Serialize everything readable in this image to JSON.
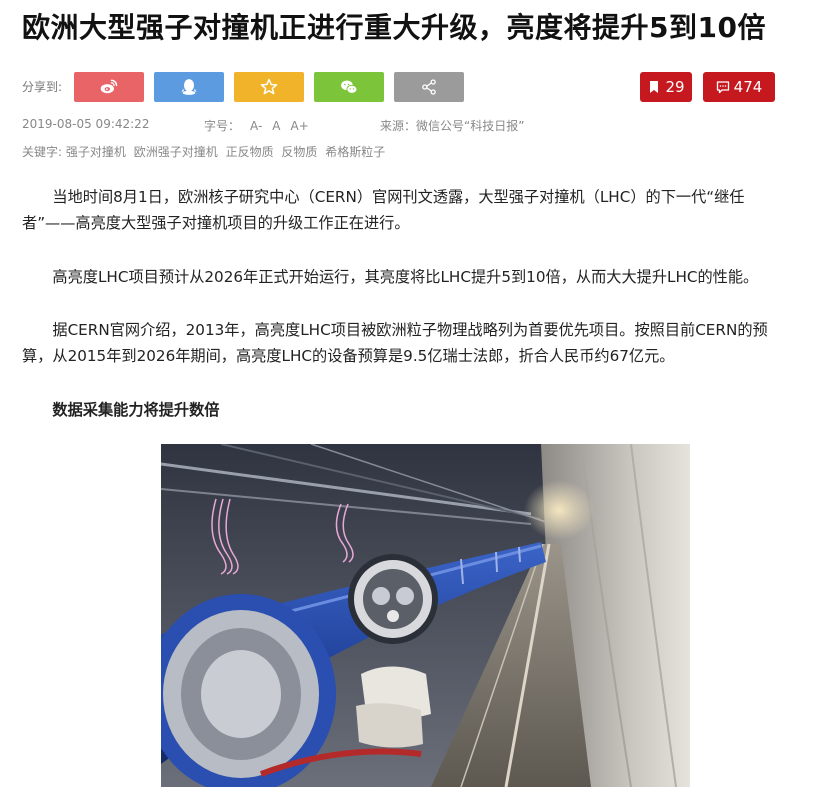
{
  "article": {
    "title": "欧洲大型强子对撞机正进行重大升级，亮度将提升5到10倍",
    "share": {
      "label": "分享到:",
      "buttons": [
        {
          "name": "weibo",
          "icon": "weibo-icon",
          "color": "#e86467"
        },
        {
          "name": "qq",
          "icon": "qq-penguin-icon",
          "color": "#5c9be0"
        },
        {
          "name": "favorite",
          "icon": "star-icon",
          "color": "#f0b32a"
        },
        {
          "name": "wechat",
          "icon": "wechat-icon",
          "color": "#7cc43a"
        },
        {
          "name": "more",
          "icon": "share-icon",
          "color": "#9b9b9b"
        }
      ]
    },
    "counts": {
      "bookmark": "29",
      "comments": "474",
      "color": "#c5181f"
    },
    "meta": {
      "date": "2019-08-05 09:42:22",
      "font_size_label": "字号：",
      "font_size_options": [
        "A-",
        "A",
        "A+"
      ],
      "source": "来源：微信公号“科技日报”"
    },
    "keywords": {
      "label": "关键字:",
      "items": [
        "强子对撞机",
        "欧洲强子对撞机",
        "正反物质",
        "反物质",
        "希格斯粒子"
      ]
    },
    "paragraphs": [
      "当地时间8月1日，欧洲核子研究中心（CERN）官网刊文透露，大型强子对撞机（LHC）的下一代“继任者”——高亮度大型强子对撞机项目的升级工作正在进行。",
      "高亮度LHC项目预计从2026年正式开始运行，其亮度将比LHC提升5到10倍，从而大大提升LHC的性能。",
      "据CERN官网介绍，2013年，高亮度LHC项目被欧洲粒子物理战略列为首要优先项目。按照目前CERN的预算，从2015年到2026年期间，高亮度LHC的设备预算是9.5亿瑞士法郎，折合人民币约67亿元。"
    ],
    "subheading": "数据采集能力将提升数倍"
  }
}
